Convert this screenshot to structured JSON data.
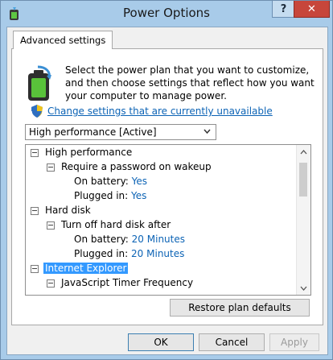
{
  "window": {
    "title": "Power Options",
    "help_label": "?",
    "close_label": "✕"
  },
  "tab": {
    "label": "Advanced settings"
  },
  "description": "Select the power plan that you want to customize, and then choose settings that reflect how you want your computer to manage power.",
  "change_link": "Change settings that are currently unavailable",
  "plan_select": {
    "selected": "High performance [Active]"
  },
  "tree": {
    "high_performance": "High performance",
    "require_password": "Require a password on wakeup",
    "on_battery_label": "On battery:",
    "on_battery_value": "Yes",
    "plugged_in_label": "Plugged in:",
    "plugged_in_value": "Yes",
    "hard_disk": "Hard disk",
    "turn_off_disk": "Turn off hard disk after",
    "disk_on_battery_label": "On battery:",
    "disk_on_battery_value": "20 Minutes",
    "disk_plugged_in_label": "Plugged in:",
    "disk_plugged_in_value": "20 Minutes",
    "internet_explorer": "Internet Explorer",
    "js_timer": "JavaScript Timer Frequency"
  },
  "buttons": {
    "restore": "Restore plan defaults",
    "ok": "OK",
    "cancel": "Cancel",
    "apply": "Apply"
  },
  "colors": {
    "link": "#0c63b5",
    "selection": "#3399ff",
    "close_button": "#c7463b",
    "frame": "#a8cbe9"
  }
}
